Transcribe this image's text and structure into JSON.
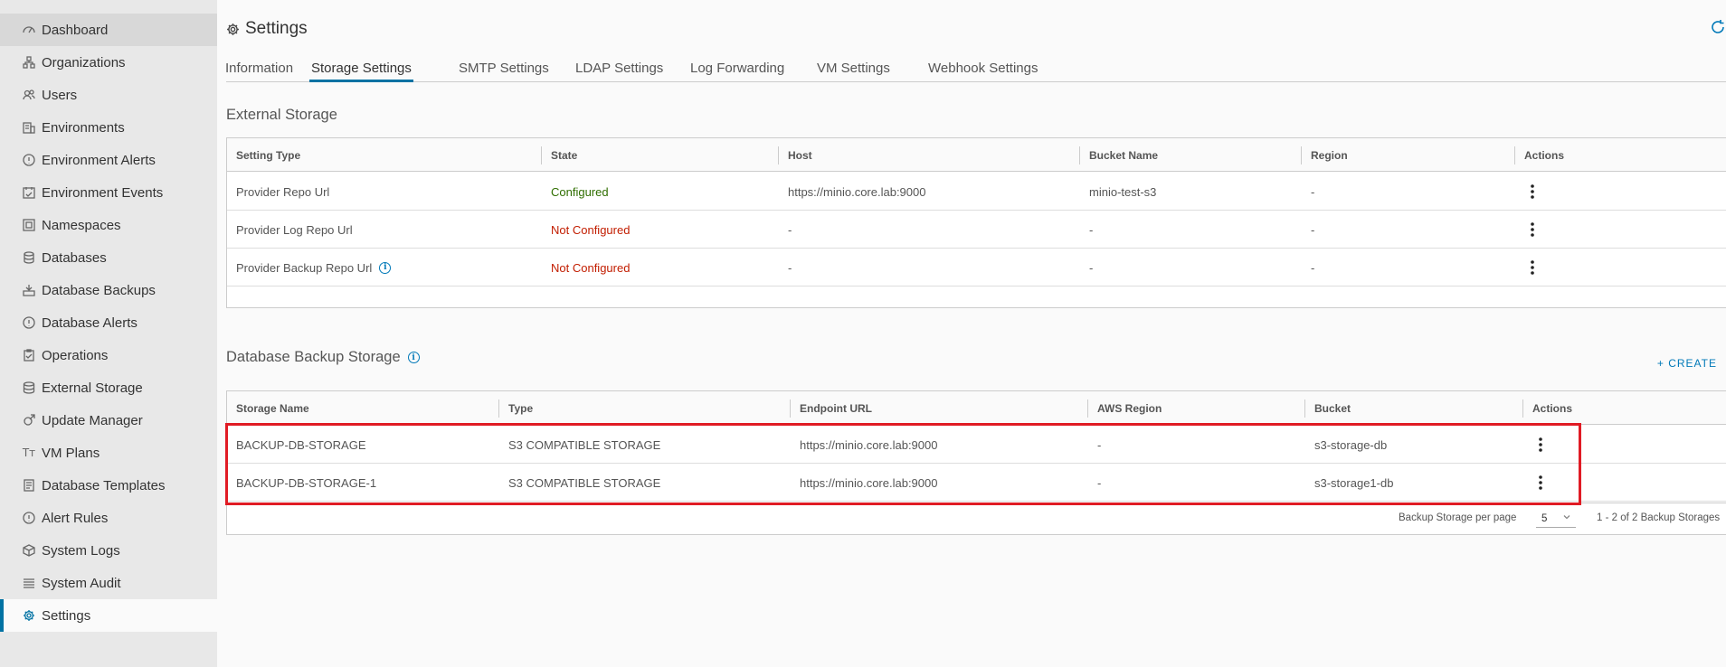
{
  "sidebar": {
    "items": [
      {
        "label": "Dashboard",
        "icon": "dashboard-icon"
      },
      {
        "label": "Organizations",
        "icon": "organizations-icon"
      },
      {
        "label": "Users",
        "icon": "users-icon"
      },
      {
        "label": "Environments",
        "icon": "environments-icon"
      },
      {
        "label": "Environment Alerts",
        "icon": "alert-icon"
      },
      {
        "label": "Environment Events",
        "icon": "calendar-icon"
      },
      {
        "label": "Namespaces",
        "icon": "namespace-icon"
      },
      {
        "label": "Databases",
        "icon": "database-icon"
      },
      {
        "label": "Database Backups",
        "icon": "backup-icon"
      },
      {
        "label": "Database Alerts",
        "icon": "alert-icon"
      },
      {
        "label": "Operations",
        "icon": "clipboard-icon"
      },
      {
        "label": "External Storage",
        "icon": "storage-icon"
      },
      {
        "label": "Update Manager",
        "icon": "update-icon"
      },
      {
        "label": "VM Plans",
        "icon": "text-icon"
      },
      {
        "label": "Database Templates",
        "icon": "template-icon"
      },
      {
        "label": "Alert Rules",
        "icon": "alert-icon"
      },
      {
        "label": "System Logs",
        "icon": "cube-icon"
      },
      {
        "label": "System Audit",
        "icon": "list-icon"
      },
      {
        "label": "Settings",
        "icon": "gear-icon"
      }
    ],
    "vm_plans_glyph": "Tт"
  },
  "header": {
    "title": "Settings"
  },
  "tabs": [
    {
      "label": "Information"
    },
    {
      "label": "Storage Settings"
    },
    {
      "label": "SMTP Settings"
    },
    {
      "label": "LDAP Settings"
    },
    {
      "label": "Log Forwarding"
    },
    {
      "label": "VM Settings"
    },
    {
      "label": "Webhook Settings"
    }
  ],
  "active_tab": "Storage Settings",
  "external_storage": {
    "title": "External Storage",
    "columns": [
      "Setting Type",
      "State",
      "Host",
      "Bucket Name",
      "Region",
      "Actions"
    ],
    "rows": [
      {
        "setting_type": "Provider Repo Url",
        "state": "Configured",
        "host": "https://minio.core.lab:9000",
        "bucket": "minio-test-s3",
        "region": "-"
      },
      {
        "setting_type": "Provider Log Repo Url",
        "state": "Not Configured",
        "host": "-",
        "bucket": "-",
        "region": "-"
      },
      {
        "setting_type": "Provider Backup Repo Url",
        "state": "Not Configured",
        "host": "-",
        "bucket": "-",
        "region": "-"
      }
    ]
  },
  "backup_storage": {
    "title": "Database Backup Storage",
    "create_label": "+ CREATE",
    "columns": [
      "Storage Name",
      "Type",
      "Endpoint URL",
      "AWS Region",
      "Bucket",
      "Actions"
    ],
    "rows": [
      {
        "name": "BACKUP-DB-STORAGE",
        "type": "S3 COMPATIBLE STORAGE",
        "endpoint": "https://minio.core.lab:9000",
        "region": "-",
        "bucket": "s3-storage-db"
      },
      {
        "name": "BACKUP-DB-STORAGE-1",
        "type": "S3 COMPATIBLE STORAGE",
        "endpoint": "https://minio.core.lab:9000",
        "region": "-",
        "bucket": "s3-storage1-db"
      }
    ],
    "pager": {
      "per_page_label": "Backup Storage per page",
      "per_page_value": "5",
      "summary": "1 - 2 of 2 Backup Storages"
    }
  },
  "colors": {
    "accent": "#0072a3",
    "configured": "#2f6e00",
    "not_configured": "#c21d00",
    "highlight": "#e01b24"
  }
}
